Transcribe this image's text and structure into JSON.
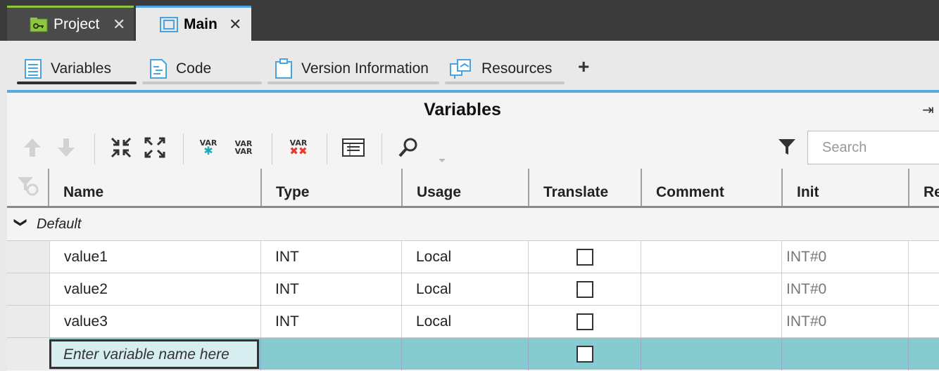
{
  "doc_tabs": [
    {
      "label": "Project",
      "close": "✕"
    },
    {
      "label": "Main",
      "close": "✕"
    }
  ],
  "sub_tabs": [
    {
      "label": "Variables",
      "icon": "variables-icon",
      "active": true
    },
    {
      "label": "Code",
      "icon": "code-icon"
    },
    {
      "label": "Version Information",
      "icon": "clipboard-icon"
    },
    {
      "label": "Resources",
      "icon": "resources-icon"
    }
  ],
  "add_tab": "+",
  "panel": {
    "title": "Variables",
    "pin": "⇥"
  },
  "toolbar": {
    "var_label": "VAR",
    "search_placeholder": "Search"
  },
  "columns": [
    "Name",
    "Type",
    "Usage",
    "Translate",
    "Comment",
    "Init",
    "Re"
  ],
  "group": {
    "name": "Default",
    "chevron": "❯"
  },
  "rows": [
    {
      "name": "value1",
      "type": "INT",
      "usage": "Local",
      "translate": false,
      "comment": "",
      "init": "INT#0"
    },
    {
      "name": "value2",
      "type": "INT",
      "usage": "Local",
      "translate": false,
      "comment": "",
      "init": "INT#0"
    },
    {
      "name": "value3",
      "type": "INT",
      "usage": "Local",
      "translate": false,
      "comment": "",
      "init": "INT#0"
    }
  ],
  "new_row": {
    "placeholder": "Enter variable name here"
  },
  "colors": {
    "accent_blue": "#5aa9de",
    "project_green": "#8dc63f",
    "new_row": "#86cbd0"
  }
}
